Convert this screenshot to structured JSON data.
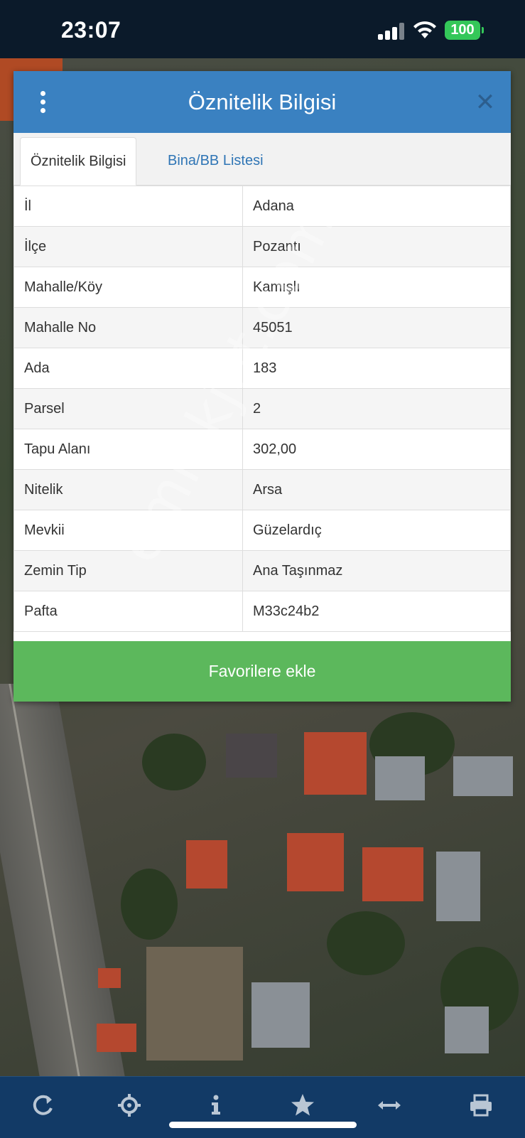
{
  "status_bar": {
    "time": "23:07",
    "battery": "100"
  },
  "dialog": {
    "title": "Öznitelik Bilgisi",
    "tabs": [
      {
        "label": "Öznitelik Bilgisi",
        "active": true
      },
      {
        "label": "Bina/BB Listesi",
        "active": false
      }
    ],
    "rows": [
      {
        "key": "İl",
        "value": "Adana"
      },
      {
        "key": "İlçe",
        "value": "Pozantı"
      },
      {
        "key": "Mahalle/Köy",
        "value": "Kamışlı"
      },
      {
        "key": "Mahalle No",
        "value": "45051"
      },
      {
        "key": "Ada",
        "value": "183"
      },
      {
        "key": "Parsel",
        "value": "2"
      },
      {
        "key": "Tapu Alanı",
        "value": "302,00"
      },
      {
        "key": "Nitelik",
        "value": "Arsa"
      },
      {
        "key": "Mevkii",
        "value": "Güzelardıç"
      },
      {
        "key": "Zemin Tip",
        "value": "Ana Taşınmaz"
      },
      {
        "key": "Pafta",
        "value": "M33c24b2"
      }
    ],
    "favorite_button": "Favorilere ekle"
  },
  "watermark": "emlakjet.com",
  "toolbar": {
    "icons": [
      "refresh-icon",
      "locate-icon",
      "info-icon",
      "star-icon",
      "measure-icon",
      "print-icon"
    ]
  },
  "colors": {
    "header_blue": "#3a81c1",
    "tab_link_blue": "#2f75b5",
    "favorite_green": "#5cb85c",
    "toolbar_navy": "#123a66",
    "battery_green": "#34c759"
  }
}
